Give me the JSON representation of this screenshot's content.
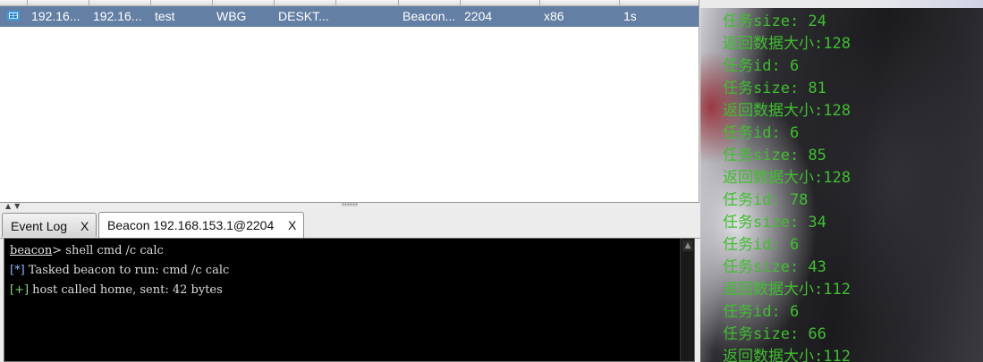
{
  "sessions_table": {
    "rows": [
      {
        "external_ip": "192.16...",
        "internal_ip": "192.16...",
        "user": "test",
        "computer": "WBG",
        "note": "DESKT...",
        "process": "Beacon...",
        "pid": "2204",
        "arch": "x86",
        "last": "1s",
        "icon": "windows-icon"
      }
    ]
  },
  "tabs": [
    {
      "label": "Event Log",
      "close": "X",
      "active": false
    },
    {
      "label": "Beacon 192.168.153.1@2204",
      "close": "X",
      "active": true
    }
  ],
  "console": {
    "prompt": "beacon",
    "prompt_sep": ">",
    "command": " shell cmd /c calc",
    "lines": [
      {
        "tag": "[*]",
        "text": " Tasked beacon to run: cmd /c calc"
      },
      {
        "tag": "[+]",
        "text": " host called home, sent: 42 bytes"
      }
    ]
  },
  "output_log": [
    "任务size: 24",
    "返回数据大小:128",
    "任务id: 6",
    "任务size: 81",
    "返回数据大小:128",
    "任务id: 6",
    "任务size: 85",
    "返回数据大小:128",
    "任务id: 78",
    "任务size: 34",
    "任务id: 6",
    "任务size: 43",
    "返回数据大小:112",
    "任务id: 6",
    "任务size: 66",
    "返回数据大小:112"
  ],
  "colors": {
    "selected_row": "#637fa4",
    "console_bg": "#000000",
    "output_text": "#3fbf2e"
  }
}
